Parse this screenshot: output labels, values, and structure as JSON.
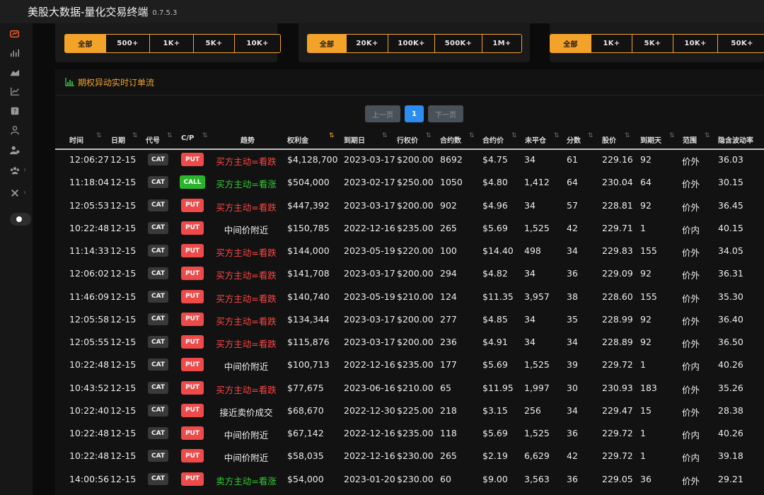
{
  "app": {
    "title": "美股大数据-量化交易终端",
    "version": "0.7.5.3"
  },
  "filters": [
    {
      "options": [
        "全部",
        "500+",
        "1K+",
        "5K+",
        "10K+"
      ],
      "active": 0
    },
    {
      "options": [
        "全部",
        "20K+",
        "100K+",
        "500K+",
        "1M+"
      ],
      "active": 0
    },
    {
      "options": [
        "全部",
        "1K+",
        "5K+",
        "10K+",
        "50K+"
      ],
      "active": 0
    }
  ],
  "panel": {
    "title": "期权异动实时订单流"
  },
  "pagination": {
    "prev": "上一页",
    "current": "1",
    "next": "下一页"
  },
  "columns": [
    "时间",
    "日期",
    "代号",
    "C/P",
    "趋势",
    "权利金",
    "到期日",
    "行权价",
    "合约数",
    "合约价",
    "未平仓",
    "分数",
    "股价",
    "到期天",
    "范围",
    "隐含波动率"
  ],
  "colors": {
    "accent": "#f3a329",
    "put": "#ef4a4a",
    "call": "#2bb52b",
    "bearish": "#ff4545",
    "bullish": "#33cc33"
  },
  "rows": [
    {
      "time": "12:06:27",
      "date": "12-15",
      "symbol": "CAT",
      "cp": "PUT",
      "trend": "买方主动=看跌",
      "trend_color": "red",
      "premium": "$4,128,700",
      "expiry": "2023-03-17",
      "strike": "$200.00",
      "contracts": "8692",
      "price": "$4.75",
      "oi": "34",
      "score": "61",
      "stock": "229.16",
      "dte": "92",
      "range": "价外",
      "iv": "36.03"
    },
    {
      "time": "11:18:04",
      "date": "12-15",
      "symbol": "CAT",
      "cp": "CALL",
      "trend": "买方主动=看涨",
      "trend_color": "green",
      "premium": "$504,000",
      "expiry": "2023-02-17",
      "strike": "$250.00",
      "contracts": "1050",
      "price": "$4.80",
      "oi": "1,412",
      "score": "64",
      "stock": "230.04",
      "dte": "64",
      "range": "价外",
      "iv": "30.15"
    },
    {
      "time": "12:05:53",
      "date": "12-15",
      "symbol": "CAT",
      "cp": "PUT",
      "trend": "买方主动=看跌",
      "trend_color": "red",
      "premium": "$447,392",
      "expiry": "2023-03-17",
      "strike": "$200.00",
      "contracts": "902",
      "price": "$4.96",
      "oi": "34",
      "score": "57",
      "stock": "228.81",
      "dte": "92",
      "range": "价外",
      "iv": "36.45"
    },
    {
      "time": "10:22:48",
      "date": "12-15",
      "symbol": "CAT",
      "cp": "PUT",
      "trend": "中间价附近",
      "trend_color": "white",
      "premium": "$150,785",
      "expiry": "2022-12-16",
      "strike": "$235.00",
      "contracts": "265",
      "price": "$5.69",
      "oi": "1,525",
      "score": "42",
      "stock": "229.71",
      "dte": "1",
      "range": "价内",
      "iv": "40.15"
    },
    {
      "time": "11:14:33",
      "date": "12-15",
      "symbol": "CAT",
      "cp": "PUT",
      "trend": "买方主动=看跌",
      "trend_color": "red",
      "premium": "$144,000",
      "expiry": "2023-05-19",
      "strike": "$220.00",
      "contracts": "100",
      "price": "$14.40",
      "oi": "498",
      "score": "34",
      "stock": "229.83",
      "dte": "155",
      "range": "价外",
      "iv": "34.05"
    },
    {
      "time": "12:06:02",
      "date": "12-15",
      "symbol": "CAT",
      "cp": "PUT",
      "trend": "买方主动=看跌",
      "trend_color": "red",
      "premium": "$141,708",
      "expiry": "2023-03-17",
      "strike": "$200.00",
      "contracts": "294",
      "price": "$4.82",
      "oi": "34",
      "score": "36",
      "stock": "229.09",
      "dte": "92",
      "range": "价外",
      "iv": "36.31"
    },
    {
      "time": "11:46:09",
      "date": "12-15",
      "symbol": "CAT",
      "cp": "PUT",
      "trend": "买方主动=看跌",
      "trend_color": "red",
      "premium": "$140,740",
      "expiry": "2023-05-19",
      "strike": "$210.00",
      "contracts": "124",
      "price": "$11.35",
      "oi": "3,957",
      "score": "38",
      "stock": "228.60",
      "dte": "155",
      "range": "价外",
      "iv": "35.30"
    },
    {
      "time": "12:05:58",
      "date": "12-15",
      "symbol": "CAT",
      "cp": "PUT",
      "trend": "买方主动=看跌",
      "trend_color": "red",
      "premium": "$134,344",
      "expiry": "2023-03-17",
      "strike": "$200.00",
      "contracts": "277",
      "price": "$4.85",
      "oi": "34",
      "score": "35",
      "stock": "228.99",
      "dte": "92",
      "range": "价外",
      "iv": "36.40"
    },
    {
      "time": "12:05:55",
      "date": "12-15",
      "symbol": "CAT",
      "cp": "PUT",
      "trend": "买方主动=看跌",
      "trend_color": "red",
      "premium": "$115,876",
      "expiry": "2023-03-17",
      "strike": "$200.00",
      "contracts": "236",
      "price": "$4.91",
      "oi": "34",
      "score": "34",
      "stock": "228.89",
      "dte": "92",
      "range": "价外",
      "iv": "36.50"
    },
    {
      "time": "10:22:48",
      "date": "12-15",
      "symbol": "CAT",
      "cp": "PUT",
      "trend": "中间价附近",
      "trend_color": "white",
      "premium": "$100,713",
      "expiry": "2022-12-16",
      "strike": "$235.00",
      "contracts": "177",
      "price": "$5.69",
      "oi": "1,525",
      "score": "39",
      "stock": "229.72",
      "dte": "1",
      "range": "价内",
      "iv": "40.26"
    },
    {
      "time": "10:43:52",
      "date": "12-15",
      "symbol": "CAT",
      "cp": "PUT",
      "trend": "买方主动=看跌",
      "trend_color": "red",
      "premium": "$77,675",
      "expiry": "2023-06-16",
      "strike": "$210.00",
      "contracts": "65",
      "price": "$11.95",
      "oi": "1,997",
      "score": "30",
      "stock": "230.93",
      "dte": "183",
      "range": "价外",
      "iv": "35.26"
    },
    {
      "time": "10:22:40",
      "date": "12-15",
      "symbol": "CAT",
      "cp": "PUT",
      "trend": "接近卖价成交",
      "trend_color": "white",
      "premium": "$68,670",
      "expiry": "2022-12-30",
      "strike": "$225.00",
      "contracts": "218",
      "price": "$3.15",
      "oi": "256",
      "score": "34",
      "stock": "229.47",
      "dte": "15",
      "range": "价外",
      "iv": "28.38"
    },
    {
      "time": "10:22:48",
      "date": "12-15",
      "symbol": "CAT",
      "cp": "PUT",
      "trend": "中间价附近",
      "trend_color": "white",
      "premium": "$67,142",
      "expiry": "2022-12-16",
      "strike": "$235.00",
      "contracts": "118",
      "price": "$5.69",
      "oi": "1,525",
      "score": "36",
      "stock": "229.72",
      "dte": "1",
      "range": "价内",
      "iv": "40.26"
    },
    {
      "time": "10:22:48",
      "date": "12-15",
      "symbol": "CAT",
      "cp": "PUT",
      "trend": "中间价附近",
      "trend_color": "white",
      "premium": "$58,035",
      "expiry": "2022-12-16",
      "strike": "$230.00",
      "contracts": "265",
      "price": "$2.19",
      "oi": "6,629",
      "score": "42",
      "stock": "229.72",
      "dte": "1",
      "range": "价内",
      "iv": "39.18"
    },
    {
      "time": "14:00:56",
      "date": "12-15",
      "symbol": "CAT",
      "cp": "PUT",
      "trend": "卖方主动=看涨",
      "trend_color": "green",
      "premium": "$54,000",
      "expiry": "2023-01-20",
      "strike": "$230.00",
      "contracts": "60",
      "price": "$9.00",
      "oi": "3,563",
      "score": "36",
      "stock": "229.05",
      "dte": "36",
      "range": "价外",
      "iv": "29.21"
    }
  ]
}
